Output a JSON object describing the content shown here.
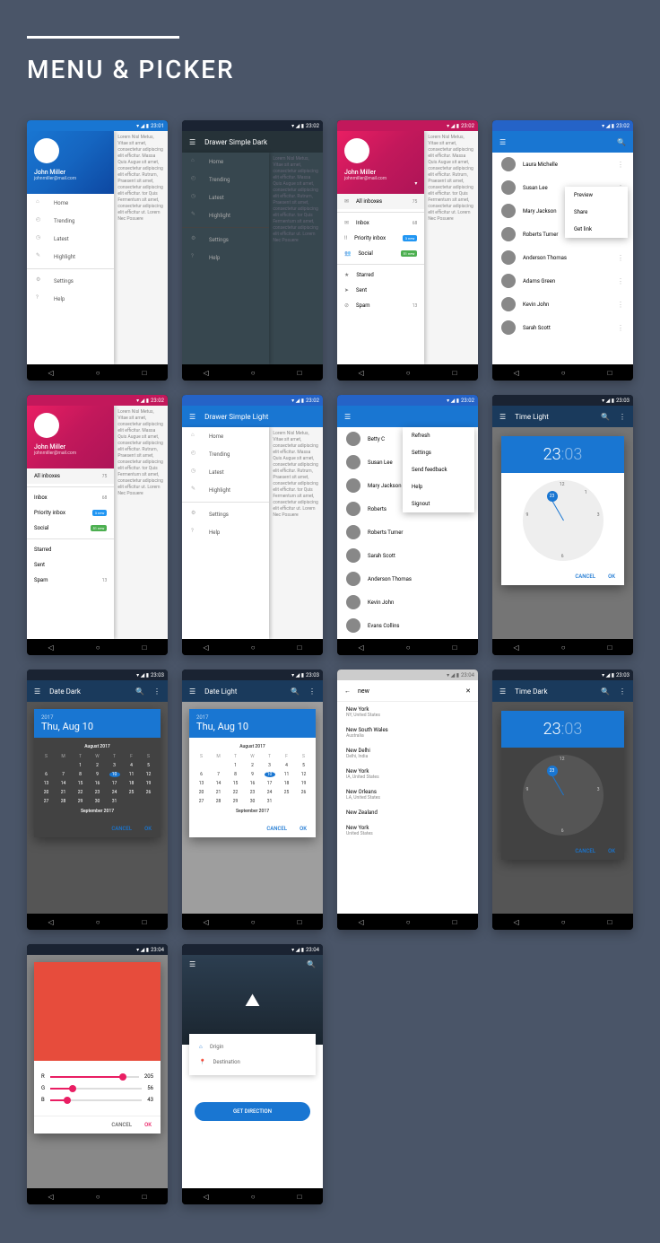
{
  "title": "MENU & PICKER",
  "status_time": "23:01",
  "status_time2": "23:02",
  "status_time3": "23:03",
  "status_time4": "23:04",
  "user": {
    "name": "John Miller",
    "email": "johnmiller@mail.com"
  },
  "drawer_items": {
    "home": "Home",
    "trending": "Trending",
    "latest": "Latest",
    "highlight": "Highlight",
    "settings": "Settings",
    "help": "Help"
  },
  "drawer_dark_title": "Drawer Simple Dark",
  "drawer_light_title": "Drawer Simple Light",
  "inbox": {
    "all": "All inboxes",
    "all_cnt": "75",
    "inbox": "Inbox",
    "inbox_cnt": "68",
    "priority": "Priority inbox",
    "priority_badge": "3 new",
    "social": "Social",
    "social_badge": "51 new",
    "starred": "Starred",
    "sent": "Sent",
    "spam": "Spam",
    "spam_cnt": "13"
  },
  "contacts": [
    "Laura Michelle",
    "Susan Lee",
    "Mary Jackson",
    "Roberts Turner",
    "Anderson Thomas",
    "Adams Green",
    "Kevin John",
    "Sarah Scott"
  ],
  "contacts2": [
    "Betty C",
    "Susan Lee",
    "Mary Jackson",
    "Roberts",
    "Roberts Turner",
    "Sarah Scott",
    "Anderson Thomas",
    "Kevin John",
    "Evans Collins"
  ],
  "ctx_menu1": [
    "Preview",
    "Share",
    "Get link"
  ],
  "ctx_menu2": [
    "Refresh",
    "Settings",
    "Send feedback",
    "Help",
    "Signout"
  ],
  "date": {
    "dark_title": "Date Dark",
    "light_title": "Date Light",
    "year": "2017",
    "full": "Thu, Aug 10",
    "month": "August 2017",
    "next_month": "September 2017",
    "dow": [
      "S",
      "M",
      "T",
      "W",
      "T",
      "F",
      "S"
    ],
    "w1": [
      "",
      "",
      "1",
      "2",
      "3",
      "4",
      "5"
    ],
    "w2": [
      "6",
      "7",
      "8",
      "9",
      "10",
      "11",
      "12"
    ],
    "w3": [
      "13",
      "14",
      "15",
      "16",
      "17",
      "18",
      "19"
    ],
    "w4": [
      "20",
      "21",
      "22",
      "23",
      "24",
      "25",
      "26"
    ],
    "w5": [
      "27",
      "28",
      "29",
      "30",
      "31",
      "",
      ""
    ],
    "cancel": "CANCEL",
    "ok": "OK"
  },
  "time": {
    "light_title": "Time Light",
    "dark_title": "Time Dark",
    "hour": "23",
    "sep": ":",
    "min": "03",
    "cancel": "CANCEL",
    "ok": "OK"
  },
  "search": {
    "query": "new",
    "results": [
      {
        "t": "New York",
        "s": "NY, United States"
      },
      {
        "t": "New South Wales",
        "s": "Australia"
      },
      {
        "t": "New Delhi",
        "s": "Delhi, India"
      },
      {
        "t": "New York",
        "s": "IA, United States"
      },
      {
        "t": "New Orleans",
        "s": "LA, United States"
      },
      {
        "t": "New Zealand",
        "s": ""
      },
      {
        "t": "New York",
        "s": "United States"
      }
    ]
  },
  "color": {
    "r_label": "R",
    "r": "205",
    "g_label": "G",
    "g": "56",
    "b_label": "B",
    "b": "43",
    "cancel": "CANCEL",
    "ok": "OK"
  },
  "direction": {
    "origin": "Origin",
    "dest": "Destination",
    "btn": "GET DIRECTION"
  },
  "filler": "Lorem Nisl Metus, Vitae sit amet, consectetur adipiscing elit efficitur. Massa Quis Augue sit amet, consectetur adipiscing elit efficitur. Rutrum, Praesent sit amet, consectetur adipiscing elit efficitur. tor Quis Fermentum sit amet, consectetur adipiscing elit efficitur ut. Lorem Nec Posuere"
}
